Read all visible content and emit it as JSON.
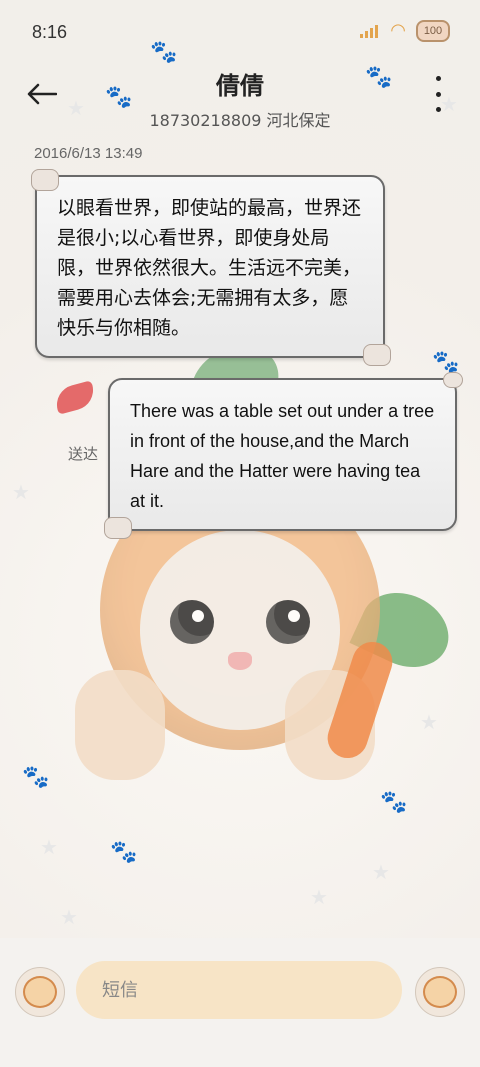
{
  "status_bar": {
    "time": "8:16",
    "battery": "100",
    "signal_icon": "signal-icon",
    "wifi_icon": "wifi-icon",
    "accent_color": "#e3a44d"
  },
  "header": {
    "title": "倩倩",
    "subtitle": "18730218809 河北保定",
    "back_icon": "back-arrow-icon",
    "more_icon": "more-vertical-icon"
  },
  "conversation": {
    "timestamp": "2016/6/13 13:49",
    "messages": [
      {
        "direction": "incoming",
        "text": "以眼看世界，即使站的最高，世界还是很小;以心看世界，即使身处局限，世界依然很大。生活远不完美，需要用心去体会;无需拥有太多，愿快乐与你相随。"
      },
      {
        "direction": "outgoing",
        "text": "There was a table set out under a tree in front of the house,and the March Hare and the Hatter were having tea at it.",
        "status": "送达"
      }
    ]
  },
  "input": {
    "placeholder": "短信",
    "value": "",
    "left_avatar_icon": "cat-avatar-icon",
    "right_avatar_icon": "send-cat-icon",
    "background_color": "#f7e4c6"
  }
}
